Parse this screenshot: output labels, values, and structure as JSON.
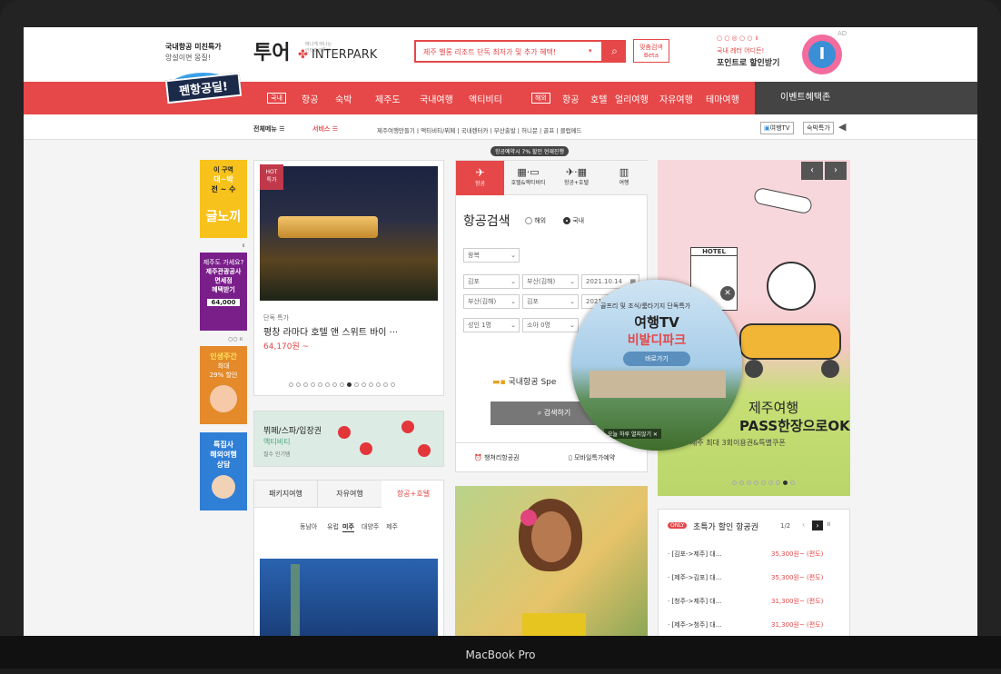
{
  "header": {
    "promo_line1": "국내항공 미친특가",
    "promo_line2": "앙설이면 몽질!",
    "logo_ko": "투어",
    "logo_tag": "에나게 떠나는\n인터파크투어",
    "logo_en": "INTERPARK",
    "search_value": "제주 벨롱 리조트 단독 최저가 및 추가 혜택!",
    "custom_search_line1": "맞춤검색",
    "custom_search_line2": "Beta",
    "points_line1": "국내 레터 어디든!",
    "points_line2": "포인트로 할인받기",
    "ad": "AD",
    "bubble_letter": "I",
    "deal_badge": "펜항공딜!"
  },
  "mainnav": {
    "domestic_tag": "국내",
    "domestic_items": [
      "항공",
      "숙박",
      "제주도",
      "국내여행",
      "액티비티"
    ],
    "overseas_tag": "해외",
    "overseas_items": [
      "항공",
      "호텔",
      "얼리여행",
      "자유여행",
      "테마여행"
    ],
    "events": "이벤트혜택존"
  },
  "subnav": {
    "all_menu": "전체메뉴",
    "service": "서비스",
    "links": "제주여행만들기 | 액티비티/뷔페 | 국내렌터카 | 부산출발 | 허니문 | 골프 | 클럽메드",
    "travel_tv": "여행TV",
    "stay_deal": "숙박특가"
  },
  "left_ads": [
    {
      "top": "이 구역",
      "mid": "대~박",
      "mid2": "전 ~ 수",
      "big": "글노끼"
    },
    {
      "line1": "제주도 가세요?",
      "line2": "제주관광공사",
      "line3": "면세점",
      "line4": "혜택받기",
      "price": "64,000"
    },
    {
      "line1": "인생주간",
      "line2": "최대",
      "line3": "29% 할인"
    },
    {
      "line1": "특집사",
      "line2": "해외여행",
      "line3": "상담"
    }
  ],
  "hotel": {
    "badge_line1": "HOT",
    "badge_line2": "특가",
    "category": "단독 특가",
    "name": "평창 라마다 호텔 앤 스위트 바이 ···",
    "price": "64,170원 ~"
  },
  "buffet": {
    "title": "뷔페/스파/입장권",
    "sub": "액티비티",
    "note": "질수 인기템"
  },
  "package": {
    "tabs": [
      "패키지여행",
      "자유여행",
      "항공+호텔"
    ],
    "regions": [
      "동남아",
      "유럽",
      "미주",
      "대양주",
      "제주"
    ]
  },
  "booking": {
    "promo": "항공예약시 7% 할인 현재진행",
    "tabs": [
      "항공",
      "호텔&액티비티",
      "항공+호텔",
      "여행"
    ],
    "title": "항공검색",
    "radio_overseas": "해외",
    "radio_domestic": "국내",
    "trip_type": "왕복",
    "from1": "김포",
    "to1": "부산(김해)",
    "date1": "2021.10.14",
    "from2": "부산(김해)",
    "to2": "김포",
    "date2": "2021.10.",
    "adult": "성인 1명",
    "child": "소아 0명",
    "promo_text": "국내항공 Spe",
    "search_btn": "검색하기",
    "bottom_left": "챙쳐리항공권",
    "bottom_right": "모바일특가예약"
  },
  "popup": {
    "line1": "골프리 및 조식/룸타기지 단독특가",
    "title": "여행TV",
    "subtitle": "비발디파크",
    "button": "바로가기",
    "close_text": "오늘 하루 열지않기 ✕"
  },
  "jeju_ad": {
    "hotel_sign": "HOTEL",
    "title": "제주여행",
    "title2": "PASS한장으로OK",
    "sub": "제주 최대 3회이용권&특별쿠폰"
  },
  "deals": {
    "badge": "ONLY",
    "title": "초특가 할인 항공권",
    "page": "1/2",
    "rows": [
      {
        "route": "· [김포->제주] 대...",
        "price": "35,300원~ (편도)"
      },
      {
        "route": "· [제주->김포] 대...",
        "price": "35,300원~ (편도)"
      },
      {
        "route": "· [청주->제주] 대...",
        "price": "31,300원~ (편도)"
      },
      {
        "route": "· [제주->청주] 대...",
        "price": "31,300원~ (편도)"
      }
    ]
  },
  "device_label": "MacBook Pro",
  "colors": {
    "brand_red": "#e64748",
    "dark": "#444444",
    "yellow_ad": "#f7c21b"
  }
}
